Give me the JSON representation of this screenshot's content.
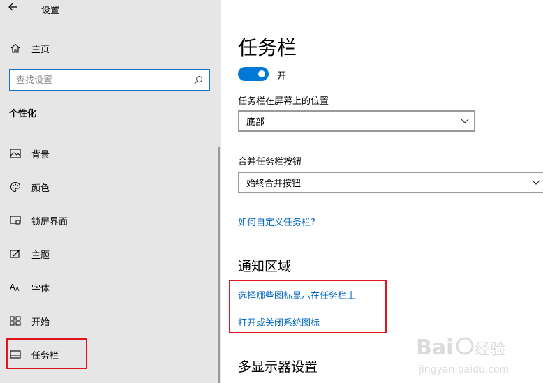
{
  "window": {
    "title": "设置"
  },
  "sidebar": {
    "home_label": "主页",
    "search_placeholder": "查找设置",
    "section_header": "个性化",
    "items": [
      {
        "label": "背景",
        "icon": "picture-icon"
      },
      {
        "label": "颜色",
        "icon": "palette-icon"
      },
      {
        "label": "锁屏界面",
        "icon": "lock-screen-icon"
      },
      {
        "label": "主题",
        "icon": "theme-icon"
      },
      {
        "label": "字体",
        "icon": "font-icon"
      },
      {
        "label": "开始",
        "icon": "start-icon"
      },
      {
        "label": "任务栏",
        "icon": "taskbar-icon",
        "selected": true
      }
    ]
  },
  "main": {
    "title": "任务栏",
    "toggle": {
      "state_label": "开",
      "on": true
    },
    "position_label": "任务栏在屏幕上的位置",
    "position_value": "底部",
    "combine_label": "合并任务栏按钮",
    "combine_value": "始终合并按钮",
    "help_link": "如何自定义任务栏?",
    "notify_title": "通知区域",
    "notify_link1": "选择哪些图标显示在任务栏上",
    "notify_link2": "打开或关闭系统图标",
    "multi_display_title": "多显示器设置"
  },
  "colors": {
    "accent": "#0078d7",
    "link": "#0067c0",
    "sidebar_bg": "#e6e6e6",
    "highlight": "#e0141e"
  }
}
